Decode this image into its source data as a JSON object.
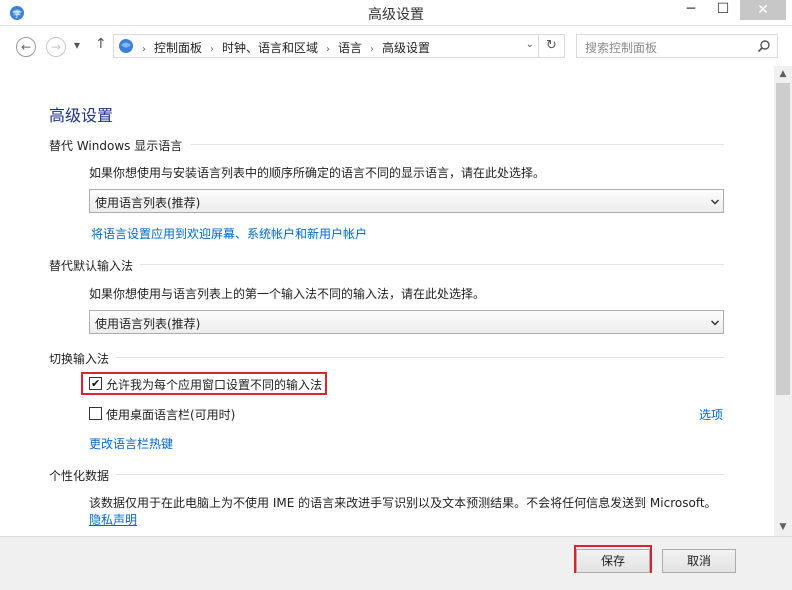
{
  "window": {
    "title": "高级设置",
    "minimize": "─",
    "maximize": "☐",
    "close": "✕"
  },
  "nav": {
    "back": "←",
    "forward": "→",
    "recent": "▾",
    "up": "↑",
    "breadcrumbs": [
      "控制面板",
      "时钟、语言和区域",
      "语言",
      "高级设置"
    ],
    "separator": "›",
    "dropdown": "⌄",
    "refresh": "↻",
    "search_placeholder": "搜索控制面板"
  },
  "main": {
    "title": "高级设置",
    "display_language": {
      "heading": "替代 Windows 显示语言",
      "description": "如果你想使用与安装语言列表中的顺序所确定的语言不同的显示语言，请在此处选择。",
      "select_value": "使用语言列表(推荐)",
      "apply_link": "将语言设置应用到欢迎屏幕、系统帐户和新用户帐户"
    },
    "default_input": {
      "heading": "替代默认输入法",
      "description": "如果你想使用与语言列表上的第一个输入法不同的输入法，请在此处选择。",
      "select_value": "使用语言列表(推荐)"
    },
    "switch_input": {
      "heading": "切换输入法",
      "per_app_label": "允许我为每个应用窗口设置不同的输入法",
      "per_app_checked": true,
      "langbar_label": "使用桌面语言栏(可用时)",
      "langbar_checked": false,
      "options_link": "选项",
      "hotkeys_link": "更改语言栏热键",
      "checkmark": "✔"
    },
    "personalization": {
      "heading": "个性化数据",
      "description": "该数据仅用于在此电脑上为不使用 IME 的语言来改进手写识别以及文本预测结果。不会将任何信息发送到 Microsoft。",
      "privacy_link": "隐私声明"
    }
  },
  "scrollbar": {
    "up": "▲",
    "down": "▼"
  },
  "footer": {
    "save": "保存",
    "cancel": "取消"
  }
}
